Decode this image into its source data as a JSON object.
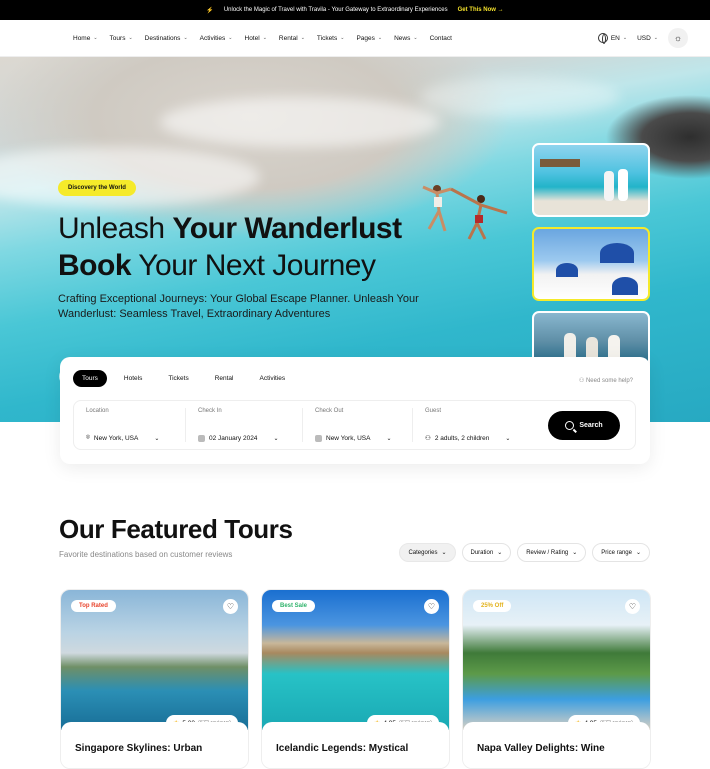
{
  "topbar": {
    "message": "Unlock the Magic of Travel with Travila - Your Gateway to Extraordinary Experiences",
    "cta": "Get This Now"
  },
  "nav": {
    "items": [
      "Home",
      "Tours",
      "Destinations",
      "Activities",
      "Hotel",
      "Rental",
      "Tickets",
      "Pages",
      "News",
      "Contact"
    ],
    "language": "EN",
    "currency": "USD"
  },
  "hero": {
    "badge": "Discovery the World",
    "title_line1_a": "Unleash ",
    "title_line1_b": "Your Wanderlust",
    "title_line2_a": "Book",
    "title_line2_b": " Your Next Journey",
    "subtitle": "Crafting Exceptional Journeys: Your Global Escape Planner. Unleash Your Wanderlust: Seamless Travel, Extraordinary Adventures"
  },
  "search": {
    "tabs": [
      "Tours",
      "Hotels",
      "Tickets",
      "Rental",
      "Activities"
    ],
    "active_tab": "Tours",
    "help": "Need some help?",
    "fields": [
      {
        "label": "Location",
        "value": "New York, USA"
      },
      {
        "label": "Check In",
        "value": "02 January 2024"
      },
      {
        "label": "Check Out",
        "value": "New York, USA"
      },
      {
        "label": "Guest",
        "value": "2 adults, 2 children"
      }
    ],
    "button": "Search"
  },
  "featured": {
    "title": "Our Featured Tours",
    "subtitle": "Favorite destinations based on customer reviews",
    "filters": [
      "Categories",
      "Duration",
      "Review / Rating",
      "Price range"
    ],
    "cards": [
      {
        "badge": "Top Rated",
        "badge_color": "#e8432b",
        "rating": "5.00",
        "reviews": "(672 reviews)",
        "title": "Singapore Skylines: Urban"
      },
      {
        "badge": "Best Sale",
        "badge_color": "#2fb36b",
        "rating": "4.95",
        "reviews": "(672 reviews)",
        "title": "Icelandic Legends: Mystical"
      },
      {
        "badge": "25% Off",
        "badge_color": "#e3b21c",
        "rating": "4.95",
        "reviews": "(672 reviews)",
        "title": "Napa Valley Delights: Wine"
      }
    ]
  },
  "colors": {
    "accent": "#f5ea2a",
    "dark": "#000000"
  }
}
